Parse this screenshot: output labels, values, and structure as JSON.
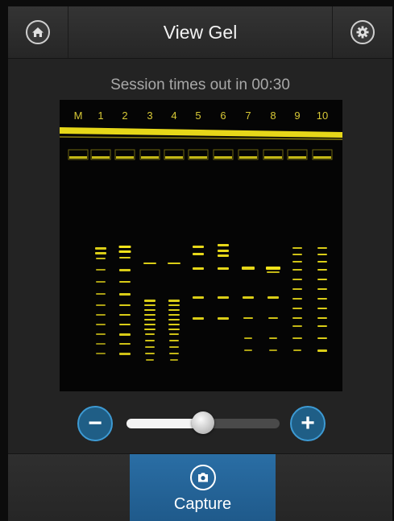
{
  "header": {
    "title": "View Gel",
    "home_icon": "home-icon",
    "settings_icon": "gear-icon"
  },
  "session": {
    "timeout_text": "Session times out in 00:30"
  },
  "gel": {
    "lane_labels": [
      "M",
      "1",
      "2",
      "3",
      "4",
      "5",
      "6",
      "7",
      "8",
      "9",
      "10"
    ],
    "band_color": "#f2e31a"
  },
  "zoom": {
    "minus_icon": "minus-icon",
    "plus_icon": "plus-icon",
    "level": 0.5
  },
  "actions": {
    "capture_label": "Capture",
    "capture_icon": "camera-icon"
  },
  "colors": {
    "accent": "#1f5e86",
    "accent_border": "#3d9ad3",
    "background": "#232323"
  }
}
